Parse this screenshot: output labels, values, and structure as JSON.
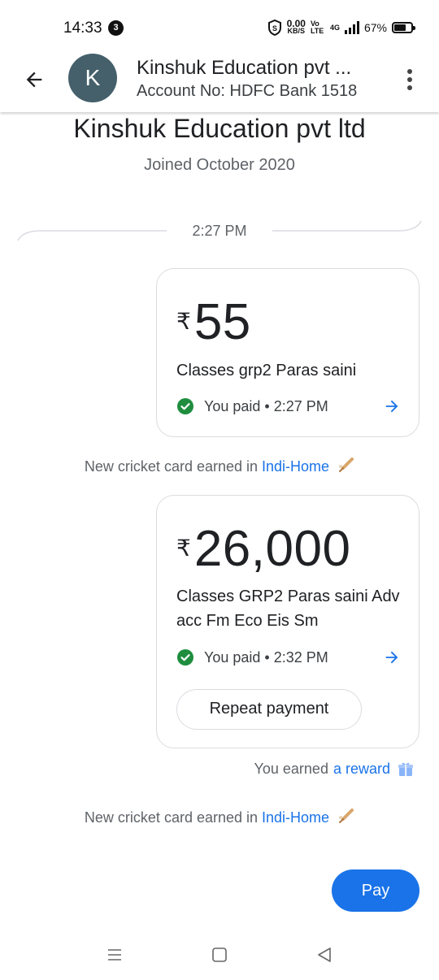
{
  "status_bar": {
    "time": "14:33",
    "notification_count": "3",
    "speed_value": "0.00",
    "speed_unit": "KB/S",
    "network_label": "Vo LTE",
    "network_type": "4G",
    "battery_percent": "67%"
  },
  "header": {
    "avatar_letter": "K",
    "title": "Kinshuk Education pvt ...",
    "subtitle": "Account No: HDFC Bank 1518"
  },
  "profile": {
    "name": "Kinshuk Education pvt ltd",
    "joined": "Joined October 2020"
  },
  "timestamp": "2:27 PM",
  "transactions": [
    {
      "currency": "₹",
      "amount": "55",
      "note": "Classes grp2 Paras saini",
      "status": "You paid • 2:27 PM"
    },
    {
      "currency": "₹",
      "amount": "26,000",
      "note": "Classes GRP2 Paras saini Adv acc Fm Eco Eis Sm",
      "status": "You paid • 2:32 PM",
      "repeat_label": "Repeat payment"
    }
  ],
  "cricket_notice": {
    "text": "New cricket card earned in",
    "link": "Indi-Home"
  },
  "reward": {
    "text": "You earned",
    "link": "a reward"
  },
  "pay_button": "Pay",
  "colors": {
    "accent": "#1a73e8",
    "avatar_bg": "#45606b",
    "success": "#1e8e3e",
    "border": "#dadce0"
  },
  "icons": [
    "back-arrow-icon",
    "more-vert-icon",
    "check-circle-icon",
    "arrow-right-icon",
    "cricket-bat-icon",
    "gift-icon",
    "nav-menu-icon",
    "nav-home-icon",
    "nav-back-icon"
  ]
}
